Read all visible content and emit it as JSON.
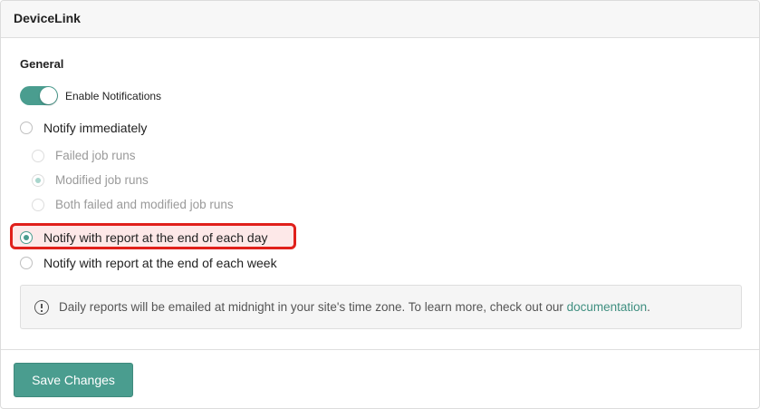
{
  "header": {
    "title": "DeviceLink"
  },
  "section": {
    "title": "General"
  },
  "toggle": {
    "label": "Enable Notifications",
    "checked": true
  },
  "options": {
    "immediately": "Notify immediately",
    "failed": "Failed job runs",
    "modified": "Modified job runs",
    "both": "Both failed and modified job runs",
    "daily": "Notify with report at the end of each day",
    "weekly": "Notify with report at the end of each week"
  },
  "selected": {
    "frequency": "daily",
    "sub_option": "modified"
  },
  "info": {
    "text": "Daily reports will be emailed at midnight in your site's time zone. To learn more, check out our ",
    "link": "documentation",
    "suffix": "."
  },
  "footer": {
    "save_label": "Save Changes"
  },
  "colors": {
    "accent": "#4a9d8f",
    "highlight_border": "#e0201b",
    "highlight_fill": "#fde8e8",
    "link": "#3f8f80"
  }
}
